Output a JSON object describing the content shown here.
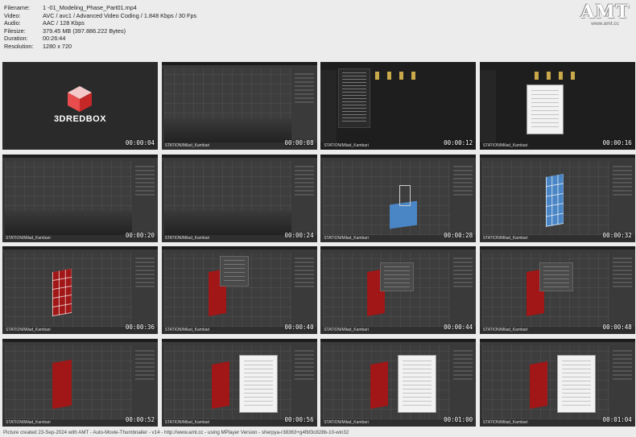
{
  "meta": {
    "rows": [
      {
        "key": "Filename:",
        "value": "1 -01_Modeling_Phase_Part01.mp4"
      },
      {
        "key": "Video:",
        "value": "AVC / avc1 / Advanced Video Coding / 1.848 Kbps / 30 Fps"
      },
      {
        "key": "Audio:",
        "value": "AAC / 128 Kbps"
      },
      {
        "key": "Filesize:",
        "value": "379.45 MB (397.886.222 Bytes)"
      },
      {
        "key": "Duration:",
        "value": "00:26:44"
      },
      {
        "key": "Resolution:",
        "value": "1280 x 720"
      }
    ]
  },
  "logo": {
    "text": "AMT",
    "url": "www.amt.cc"
  },
  "thumbs": [
    {
      "time": "00:00:04",
      "kind": "logo",
      "brand": "3DREDBOX"
    },
    {
      "time": "00:00:08",
      "kind": "max-empty",
      "watermark": "STATION/Milad_Kambari"
    },
    {
      "time": "00:00:12",
      "kind": "explorer",
      "watermark": "STATION/Milad_Kambari"
    },
    {
      "time": "00:00:16",
      "kind": "explorer-dialog",
      "watermark": "STATION/Milad_Kambari"
    },
    {
      "time": "00:00:20",
      "kind": "max-empty",
      "watermark": "STATION/Milad_Kambari"
    },
    {
      "time": "00:00:24",
      "kind": "max-empty",
      "watermark": "STATION/Milad_Kambari"
    },
    {
      "time": "00:00:28",
      "kind": "blue-box",
      "watermark": "STATION/Milad_Kambari"
    },
    {
      "time": "00:00:32",
      "kind": "blue-plane",
      "watermark": "STATION/Milad_Kambari"
    },
    {
      "time": "00:00:36",
      "kind": "red-grid",
      "watermark": "STATION/Milad_Kambari"
    },
    {
      "time": "00:00:40",
      "kind": "red-menu",
      "watermark": "STATION/Milad_Kambari"
    },
    {
      "time": "00:00:44",
      "kind": "red-dialog",
      "watermark": "STATION/Milad_Kambari"
    },
    {
      "time": "00:00:48",
      "kind": "red-dialog",
      "watermark": "STATION/Milad_Kambari"
    },
    {
      "time": "00:00:52",
      "kind": "red-plain",
      "watermark": "STATION/Milad_Kambari"
    },
    {
      "time": "00:00:56",
      "kind": "red-white-dialog",
      "watermark": "STATION/Milad_Kambari"
    },
    {
      "time": "00:01:00",
      "kind": "red-white-dialog",
      "watermark": "STATION/Milad_Kambari"
    },
    {
      "time": "00:01:04",
      "kind": "red-white-dialog",
      "watermark": "STATION/Milad_Kambari"
    }
  ],
  "footer": "Picture created 23-Sep-2024 with AMT - Auto-Movie-Thumbnailer - v14 - http://www.amt.cc - using MPlayer Version - sherpya-r38363+g4fbf3c828b-10-win32"
}
